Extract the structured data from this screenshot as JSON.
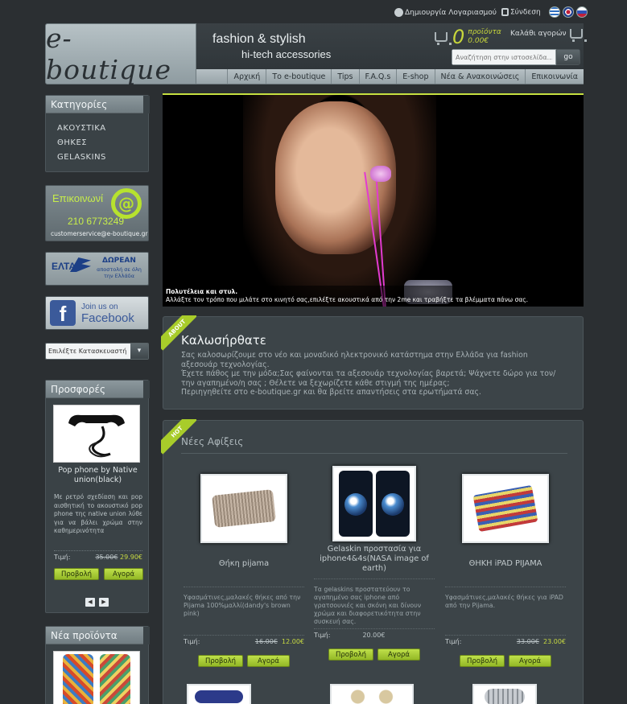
{
  "top_links": {
    "create_account": "Δημιουργία Λογαριασμού",
    "login": "Σύνδεση"
  },
  "languages": [
    "greek-flag-icon",
    "english-flag-icon",
    "russian-flag-icon"
  ],
  "header": {
    "logo": "e-boutique",
    "tagline_1": "fashion & stylish",
    "tagline_2": "hi-tech accessories"
  },
  "cart": {
    "count": "0",
    "items_label": "προϊόντα",
    "total": "0.00€",
    "link": "Καλάθι αγορών"
  },
  "search": {
    "placeholder": "Αναζήτηση στην ιστοσελίδα...",
    "button": "go"
  },
  "nav": [
    "Αρχική",
    "Το e-boutique",
    "Tips",
    "F.A.Q.s",
    "E-shop",
    "Νέα & Ανακοινώσεις",
    "Επικοινωνία"
  ],
  "categories": {
    "title": "Κατηγορίες",
    "items": [
      "ΑΚΟΥΣΤΙΚΑ",
      "ΘΗΚΕΣ",
      "GELASKINS"
    ]
  },
  "contact_banner": {
    "title": "Επικοινωνί",
    "at": "@",
    "phone": "210 6773249",
    "email": "customerservice@e-boutique.gr"
  },
  "elta_banner": {
    "logo": "ΕΛΤΑ",
    "free": "ΔΩΡΕΑΝ",
    "sub": "αποστολή σε όλη την Ελλάδα"
  },
  "fb_banner": {
    "icon": "f",
    "join": "Join us on",
    "name": "Facebook"
  },
  "manufacturer_select": {
    "value": "Επιλέξτε Κατασκευαστή",
    "arrow": "▾"
  },
  "offers": {
    "title": "Προσφορές",
    "product": {
      "title": "Pop phone by Native union(black)",
      "desc": "Με ρετρό σχεδίαση και pop αισθητική το ακουστικό pop phone της native union λύθε για να βάλει χρώμα στην καθημερινότητα",
      "price_label": "Τιμή:",
      "old_price": "35.00€",
      "new_price": "29.90€",
      "view": "Προβολή",
      "buy": "Αγορά"
    },
    "prev": "◀",
    "next": "▶"
  },
  "new_products": {
    "title": "Νέα προϊόντα"
  },
  "slider": {
    "caption_title": "Πολυτέλεια και στυλ.",
    "caption_text": "Αλλάξτε τον τρόπο που μιλάτε στο κινητό σας,επιλέξτε ακουστικά από την 2me και τραβήξτε τα βλέμματα πάνω σας."
  },
  "welcome": {
    "ribbon": "ABOUT",
    "title": "Καλωσήρθατε",
    "text_1": "Σας καλοσωρίζουμε στο νέο και μοναδικό ηλεκτρονικό κατάστημα στην Ελλάδα για fashion αξεσουάρ τεχνολογίας.",
    "text_2": " Έχετε πάθος με την μόδα;Σας φαίνονται τα αξεσουάρ τεχνολογίας βαρετά; Ψάχνετε δώρο για τον/την αγαπημένο/η σας ; Θέλετε να ξεχωρίζετε κάθε στιγμή της ημέρας;",
    "text_3": " Περιηγηθείτε στο e-boutique.gr και θα βρείτε απαντήσεις στα ερωτήματά σας."
  },
  "arrivals": {
    "ribbon": "HOT",
    "title": "Νέες Αφίξεις",
    "price_label": "Τιμή:",
    "view": "Προβολή",
    "buy": "Αγορά",
    "products": [
      {
        "title": "Θήκη pijama",
        "desc": "Υφασμάτινες,μαλακές θήκες από την Pijama 100%μαλλί(dandy's brown pink)",
        "old_price": "16.00€",
        "new_price": "12.00€"
      },
      {
        "title": "Gelaskin προστασία για iphone4&4s(NASA image of earth)",
        "desc": "Τα gelaskins προστατεύουν το αγαπημένο σας iphone από γρατσουνιές και σκόνη και δίνουν χρώμα και διαφορετικότητα στην συσκευή σας.",
        "old_price": "",
        "new_price": "20.00€"
      },
      {
        "title": "ΘΗΚΗ iPAD PIJAMA",
        "desc": "Υφασμάτινες,μαλακές θήκες για iPAD από την Pijama.",
        "old_price": "33.00€",
        "new_price": "23.00€"
      }
    ]
  }
}
